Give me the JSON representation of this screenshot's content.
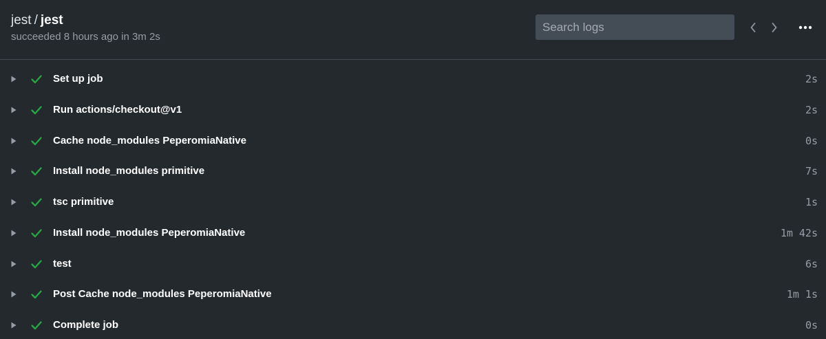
{
  "header": {
    "owner": "jest",
    "separator": "/",
    "repo": "jest",
    "status": "succeeded 8 hours ago in 3m 2s"
  },
  "search": {
    "placeholder": "Search logs",
    "value": ""
  },
  "icons": {
    "prev": "chevron-left-icon",
    "next": "chevron-right-icon",
    "more": "kebab-horizontal-icon",
    "expand": "triangle-right-icon",
    "success": "check-icon"
  },
  "colors": {
    "background": "#24292e",
    "success": "#28a745",
    "muted": "#959da5",
    "search_bg": "#444c56"
  },
  "steps": [
    {
      "name": "Set up job",
      "duration": "2s"
    },
    {
      "name": "Run actions/checkout@v1",
      "duration": "2s"
    },
    {
      "name": "Cache node_modules PeperomiaNative",
      "duration": "0s"
    },
    {
      "name": "Install node_modules primitive",
      "duration": "7s"
    },
    {
      "name": "tsc primitive",
      "duration": "1s"
    },
    {
      "name": "Install node_modules PeperomiaNative",
      "duration": "1m 42s"
    },
    {
      "name": "test",
      "duration": "6s"
    },
    {
      "name": "Post Cache node_modules PeperomiaNative",
      "duration": "1m 1s"
    },
    {
      "name": "Complete job",
      "duration": "0s"
    }
  ]
}
